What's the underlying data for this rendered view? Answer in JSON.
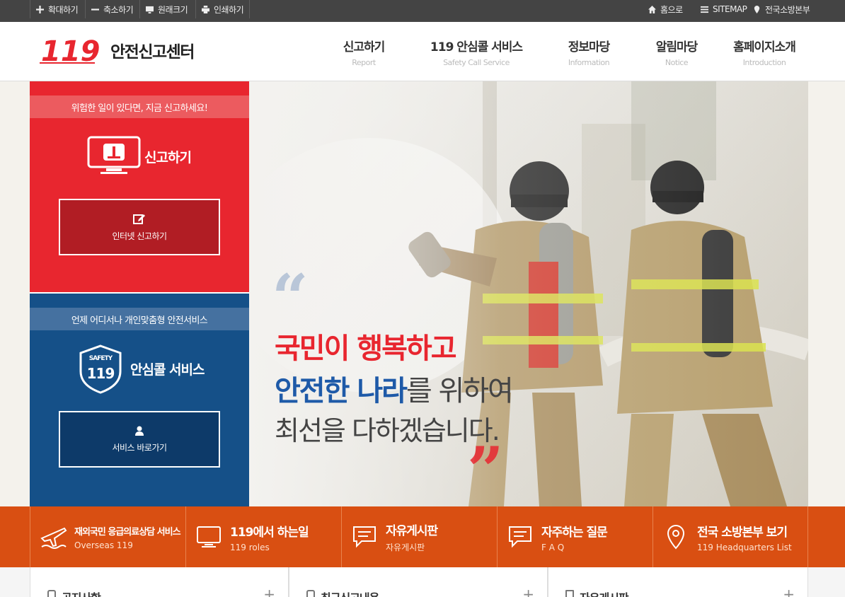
{
  "topbar": {
    "zoom_in": "확대하기",
    "zoom_out": "축소하기",
    "original_size": "원래크기",
    "print": "인쇄하기",
    "home": "홈으로",
    "sitemap": "SITEMAP",
    "hq": "전국소방본부"
  },
  "header": {
    "logo_mark": "119",
    "title": "안전신고센터",
    "nav": [
      {
        "ko": "신고하기",
        "en": "Report"
      },
      {
        "ko": "119 안심콜 서비스",
        "en": "Safety Call Service"
      },
      {
        "ko": "정보마당",
        "en": "Information"
      },
      {
        "ko": "알림마당",
        "en": "Notice"
      },
      {
        "ko": "홈페이지소개",
        "en": "Introduction"
      }
    ]
  },
  "report_panel": {
    "banner": "위험한 일이 있다면, 지금 신고하세요!",
    "title": "신고하기",
    "button": "인터넷 신고하기"
  },
  "safety_panel": {
    "banner": "언제 어디서나 개인맞춤형 안전서비스",
    "badge_top": "SAFETY",
    "badge_num": "119",
    "title": "안심콜 서비스",
    "button": "서비스 바로가기"
  },
  "hero": {
    "line1": "국민이 행복하고",
    "line2_a": "안전한 나라",
    "line2_b": "를 위하여",
    "line3": "최선을 다하겠습니다.",
    "open_quote": "“",
    "close_quote": "”"
  },
  "quicklinks": [
    {
      "title": "재외국민 응급의료상담 서비스",
      "sub": "Overseas 119"
    },
    {
      "title": "119에서 하는일",
      "sub": "119 roles"
    },
    {
      "title": "자유게시판",
      "sub": "자유게시판"
    },
    {
      "title": "자주하는 질문",
      "sub": "F A Q"
    },
    {
      "title": "전국 소방본부 보기",
      "sub": "119 Headquarters List"
    }
  ],
  "boards": [
    {
      "title": "공지사항"
    },
    {
      "title": "최근신고내용"
    },
    {
      "title": "자유게시판"
    }
  ],
  "colors": {
    "red": "#e8262f",
    "blue": "#155088",
    "orange": "#d94f12"
  }
}
